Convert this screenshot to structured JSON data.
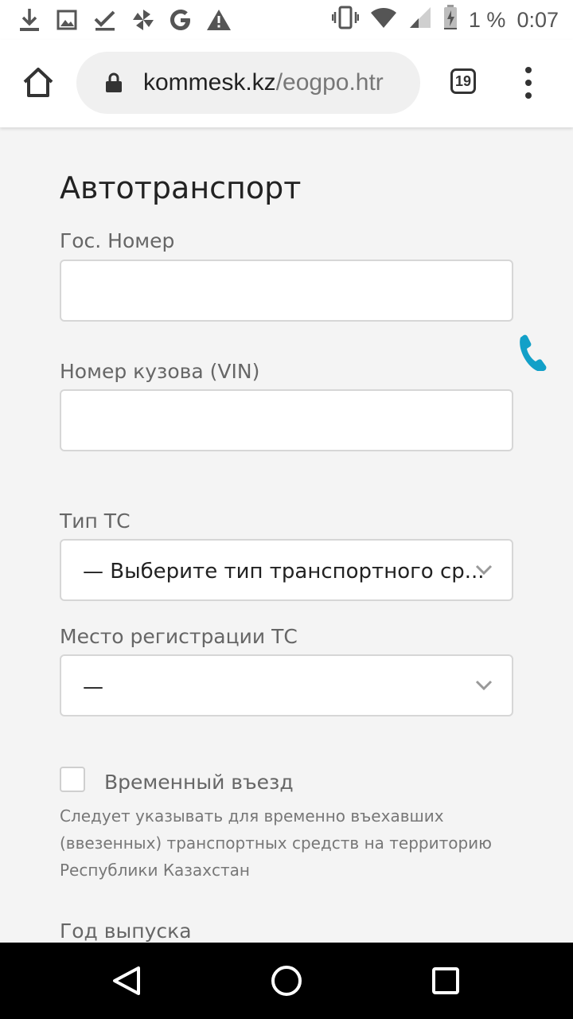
{
  "status_bar": {
    "icons_left": [
      "download-icon",
      "image-icon",
      "check-icon",
      "pinwheel-icon",
      "google-icon",
      "warning-icon"
    ],
    "icons_right": [
      "vibrate-icon",
      "wifi-icon",
      "signal-icon",
      "battery-charging-icon"
    ],
    "battery": "1 %",
    "time": "0:07"
  },
  "browser": {
    "url_domain": "kommesk.kz",
    "url_path": "/eogpo.htr",
    "tab_count": "19"
  },
  "form": {
    "heading": "Автотранспорт",
    "plate_label": "Гос. Номер",
    "plate_value": "",
    "vin_label": "Номер кузова (VIN)",
    "vin_value": "",
    "type_label": "Тип ТС",
    "type_value": "— Выберите тип транспортного ср...",
    "reg_label": "Место регистрации ТС",
    "reg_value": "—",
    "temp_entry_label": "Временный въезд",
    "temp_entry_checked": false,
    "temp_entry_help": "Следует указывать для временно въехавших (ввезенных) транспортных средств на территорию Республики Казахстан",
    "year_label": "Год выпуска"
  },
  "colors": {
    "accent_phone": "#12a0c8",
    "page_bg": "#f4f4f4"
  },
  "nav": {
    "icons": [
      "back-icon",
      "home-circle-icon",
      "recents-icon"
    ]
  }
}
